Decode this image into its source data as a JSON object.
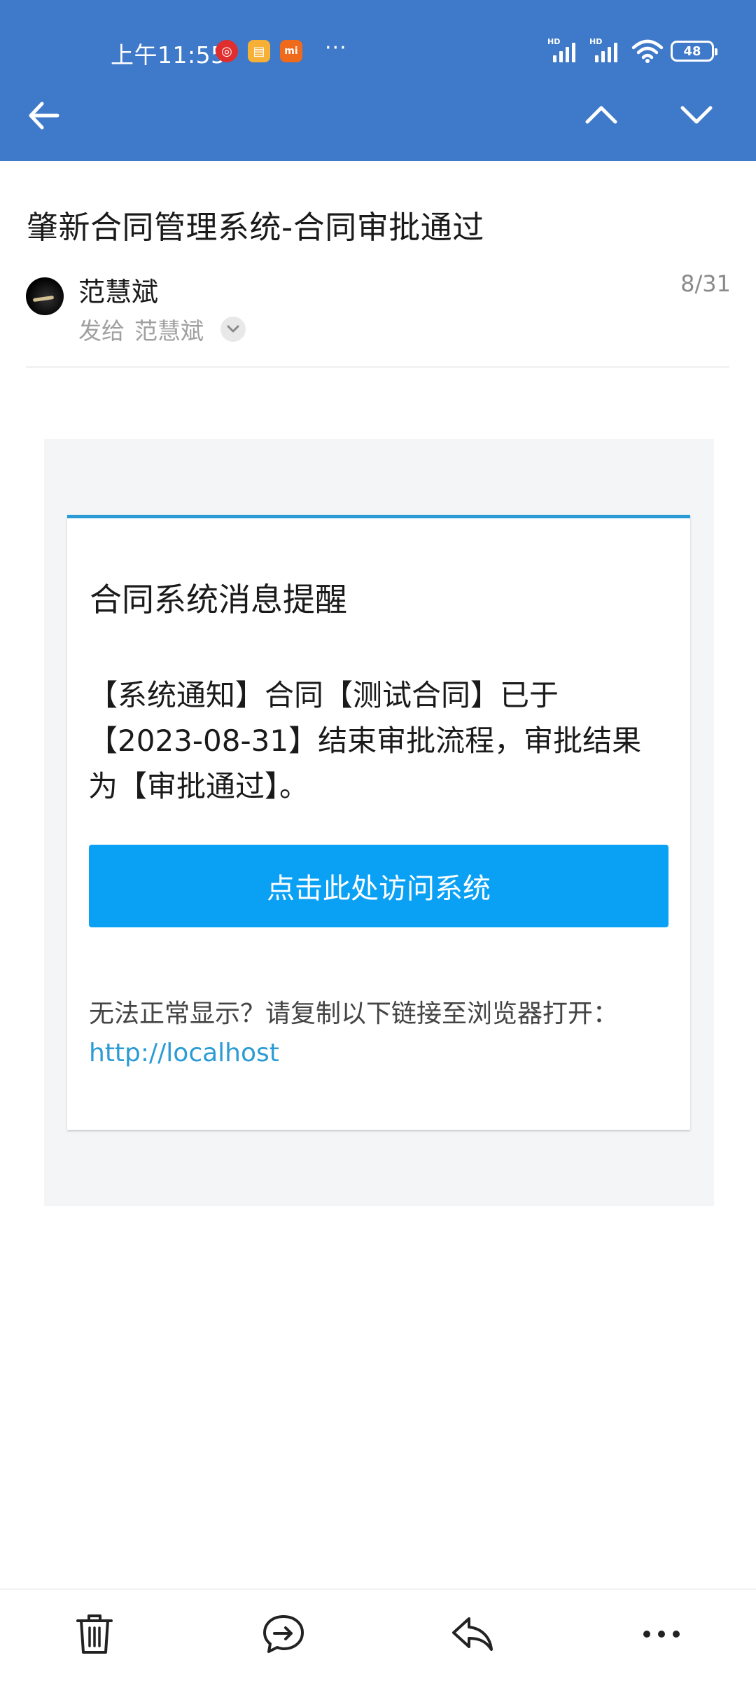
{
  "status_bar": {
    "time": "上午11:55",
    "notif_icons": [
      "netease-music-icon",
      "gallery-icon",
      "mi-icon"
    ],
    "more": "···",
    "hd_label": "HD",
    "battery": "48"
  },
  "nav": {
    "back_icon": "arrow-left-icon",
    "prev_icon": "chevron-up-icon",
    "next_icon": "chevron-down-icon"
  },
  "mail": {
    "subject": "肇新合同管理系统-合同审批通过",
    "sender": "范慧斌",
    "to_label": "发给",
    "recipient": "范慧斌",
    "date": "8/31"
  },
  "card": {
    "title": "合同系统消息提醒",
    "message": "【系统通知】合同【测试合同】已于【2023-08-31】结束审批流程，审批结果为【审批通过】。",
    "button_label": "点击此处访问系统",
    "hint": "无法正常显示？请复制以下链接至浏览器打开：",
    "link": "http://localhost"
  },
  "bottom_bar": {
    "actions": [
      "delete-icon",
      "forward-icon",
      "reply-icon",
      "more-icon"
    ]
  },
  "colors": {
    "header": "#3f79c9",
    "accent_line": "#2a9bd5",
    "button": "#0aa1f5",
    "link": "#2a9bd5"
  }
}
